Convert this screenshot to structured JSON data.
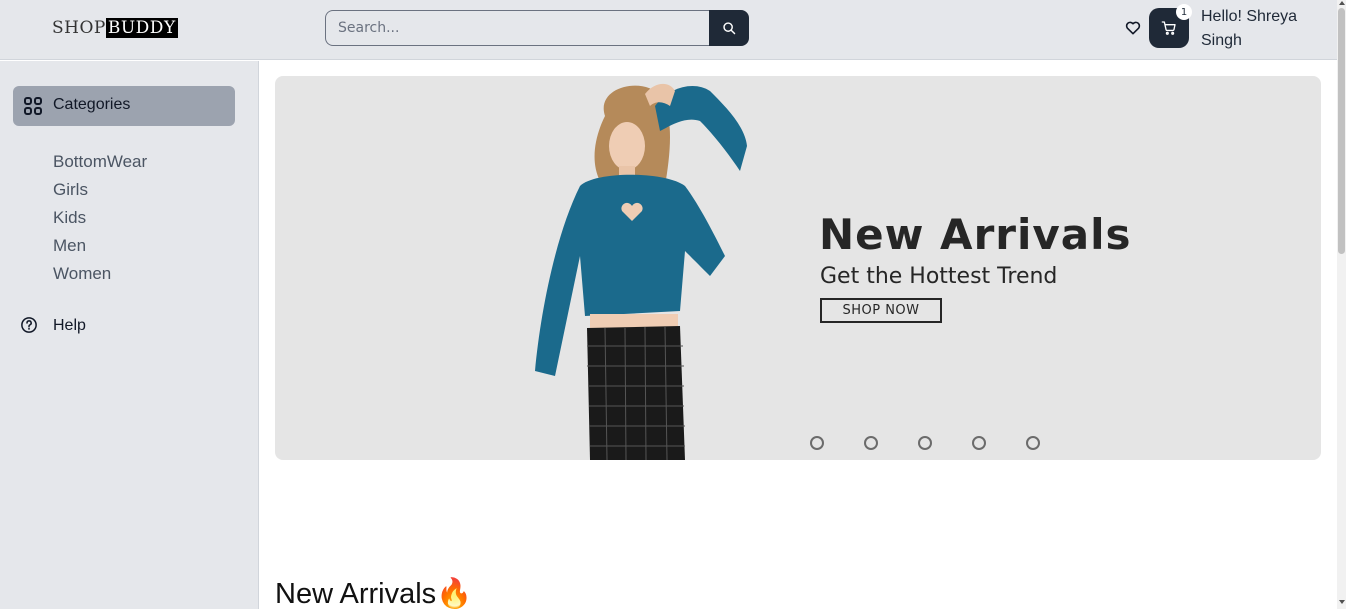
{
  "header": {
    "logo_part1": "SHOP",
    "logo_part2": "BUDDY",
    "search_placeholder": "Search...",
    "cart_count": "1",
    "greeting": "Hello! Shreya Singh"
  },
  "sidebar": {
    "categories_label": "Categories",
    "items": [
      {
        "label": "BottomWear"
      },
      {
        "label": "Girls"
      },
      {
        "label": "Kids"
      },
      {
        "label": "Men"
      },
      {
        "label": "Women"
      }
    ],
    "help_label": "Help"
  },
  "banner": {
    "title": "New Arrivals",
    "subtitle": "Get the Hottest Trend",
    "cta": "SHOP NOW",
    "slide_count": 5
  },
  "section": {
    "title": "New Arrivals🔥"
  },
  "colors": {
    "header_bg": "#e5e7eb",
    "dark": "#1f2937",
    "active_category": "#9ca3af",
    "banner_bg": "#e5e5e5"
  },
  "icons": [
    "search-icon",
    "heart-icon",
    "cart-icon",
    "grid-icon",
    "help-icon"
  ]
}
